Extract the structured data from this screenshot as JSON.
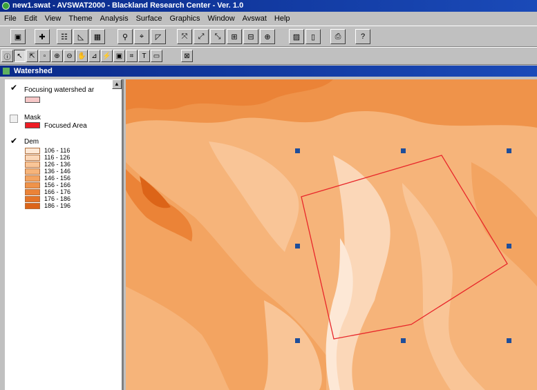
{
  "window": {
    "title": "new1.swat - AVSWAT2000 - Blackland Research Center - Ver. 1.0"
  },
  "menu": [
    "File",
    "Edit",
    "View",
    "Theme",
    "Analysis",
    "Surface",
    "Graphics",
    "Window",
    "Avswat",
    "Help"
  ],
  "view": {
    "title": "Watershed"
  },
  "legend": {
    "focusing": {
      "label": "Focusing watershed ar",
      "checked": true,
      "swatch_color": "#f6c7c7"
    },
    "mask": {
      "label": "Mask",
      "checked": false,
      "item_label": "Focused Area",
      "swatch_color": "#ee1c24"
    },
    "dem": {
      "label": "Dem",
      "checked": true,
      "classes": [
        {
          "range": "106 - 116",
          "color": "#fde8d6"
        },
        {
          "range": "116 - 126",
          "color": "#fbd7b8"
        },
        {
          "range": "126 - 136",
          "color": "#f9c597"
        },
        {
          "range": "136 - 146",
          "color": "#f6b47a"
        },
        {
          "range": "146 - 156",
          "color": "#f3a461"
        },
        {
          "range": "156 - 166",
          "color": "#ef934a"
        },
        {
          "range": "166 - 176",
          "color": "#eb8337"
        },
        {
          "range": "176 - 186",
          "color": "#e57427"
        },
        {
          "range": "186 - 196",
          "color": "#dc6418"
        }
      ]
    }
  },
  "map": {
    "polygon_color": "#e8262a",
    "handle_color": "#1f4e9a"
  }
}
